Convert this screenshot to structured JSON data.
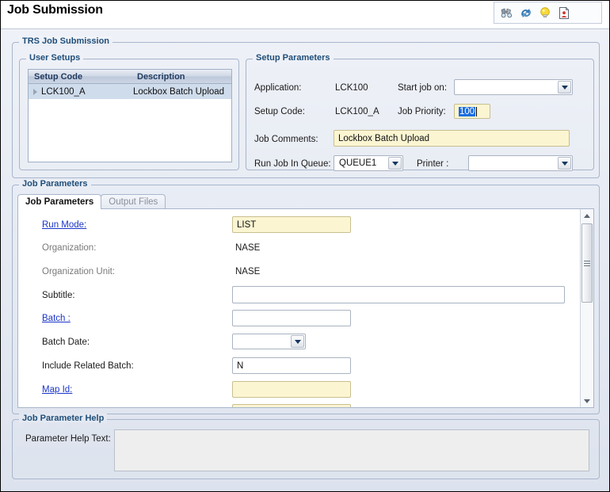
{
  "window": {
    "title": "Job Submission"
  },
  "toolbar": {
    "icons": [
      {
        "name": "binoculars-icon",
        "label": "Find"
      },
      {
        "name": "refresh-icon",
        "label": "Refresh"
      },
      {
        "name": "lightbulb-icon",
        "label": "Hint"
      },
      {
        "name": "report-document-icon",
        "label": "Report"
      }
    ]
  },
  "groups": {
    "trs": "TRS Job Submission",
    "user_setups": "User Setups",
    "setup_parameters": "Setup Parameters",
    "job_parameters": "Job Parameters",
    "job_parameter_help": "Job Parameter Help"
  },
  "user_setups": {
    "columns": [
      "Setup Code",
      "Description"
    ],
    "rows": [
      {
        "setup_code": "LCK100_A",
        "description": "Lockbox Batch Upload",
        "selected": true
      }
    ]
  },
  "setup_parameters": {
    "application_label": "Application:",
    "application_value": "LCK100",
    "start_job_on_label": "Start job on:",
    "start_job_on_value": "",
    "setup_code_label": "Setup Code:",
    "setup_code_value": "LCK100_A",
    "job_priority_label": "Job Priority:",
    "job_priority_value": "100",
    "job_comments_label": "Job Comments:",
    "job_comments_value": "Lockbox Batch Upload",
    "run_job_in_queue_label": "Run Job In Queue:",
    "run_job_in_queue_value": "QUEUE1",
    "printer_label": "Printer :",
    "printer_value": ""
  },
  "tabs": [
    {
      "label": "Job Parameters",
      "active": true
    },
    {
      "label": "Output Files",
      "active": false
    }
  ],
  "job_parameters_fields": [
    {
      "label": "Run Mode:",
      "value": "LIST",
      "kind": "text-yellow",
      "link": true
    },
    {
      "label": "Organization:",
      "value": "NASE",
      "kind": "static",
      "link": false
    },
    {
      "label": "Organization Unit:",
      "value": "NASE",
      "kind": "static",
      "link": false
    },
    {
      "label": "Subtitle:",
      "value": "",
      "kind": "text-wide",
      "link": false
    },
    {
      "label": "Batch :",
      "value": "",
      "kind": "text",
      "link": true
    },
    {
      "label": "Batch Date:",
      "value": "",
      "kind": "combo",
      "link": false
    },
    {
      "label": "Include Related Batch:",
      "value": "N",
      "kind": "text",
      "link": false
    },
    {
      "label": "Map Id:",
      "value": "",
      "kind": "text-yellow",
      "link": true
    },
    {
      "label": "",
      "value": "",
      "kind": "text-yellow-partial",
      "link": false
    }
  ],
  "help": {
    "parameter_help_text_label": "Parameter Help Text:",
    "parameter_help_text_value": ""
  },
  "colors": {
    "accent": "#1f4e79",
    "link": "#1a35c8",
    "required_field": "#fbf5d2",
    "selection": "#1b6ee0",
    "row_selected": "#cfdcec"
  }
}
